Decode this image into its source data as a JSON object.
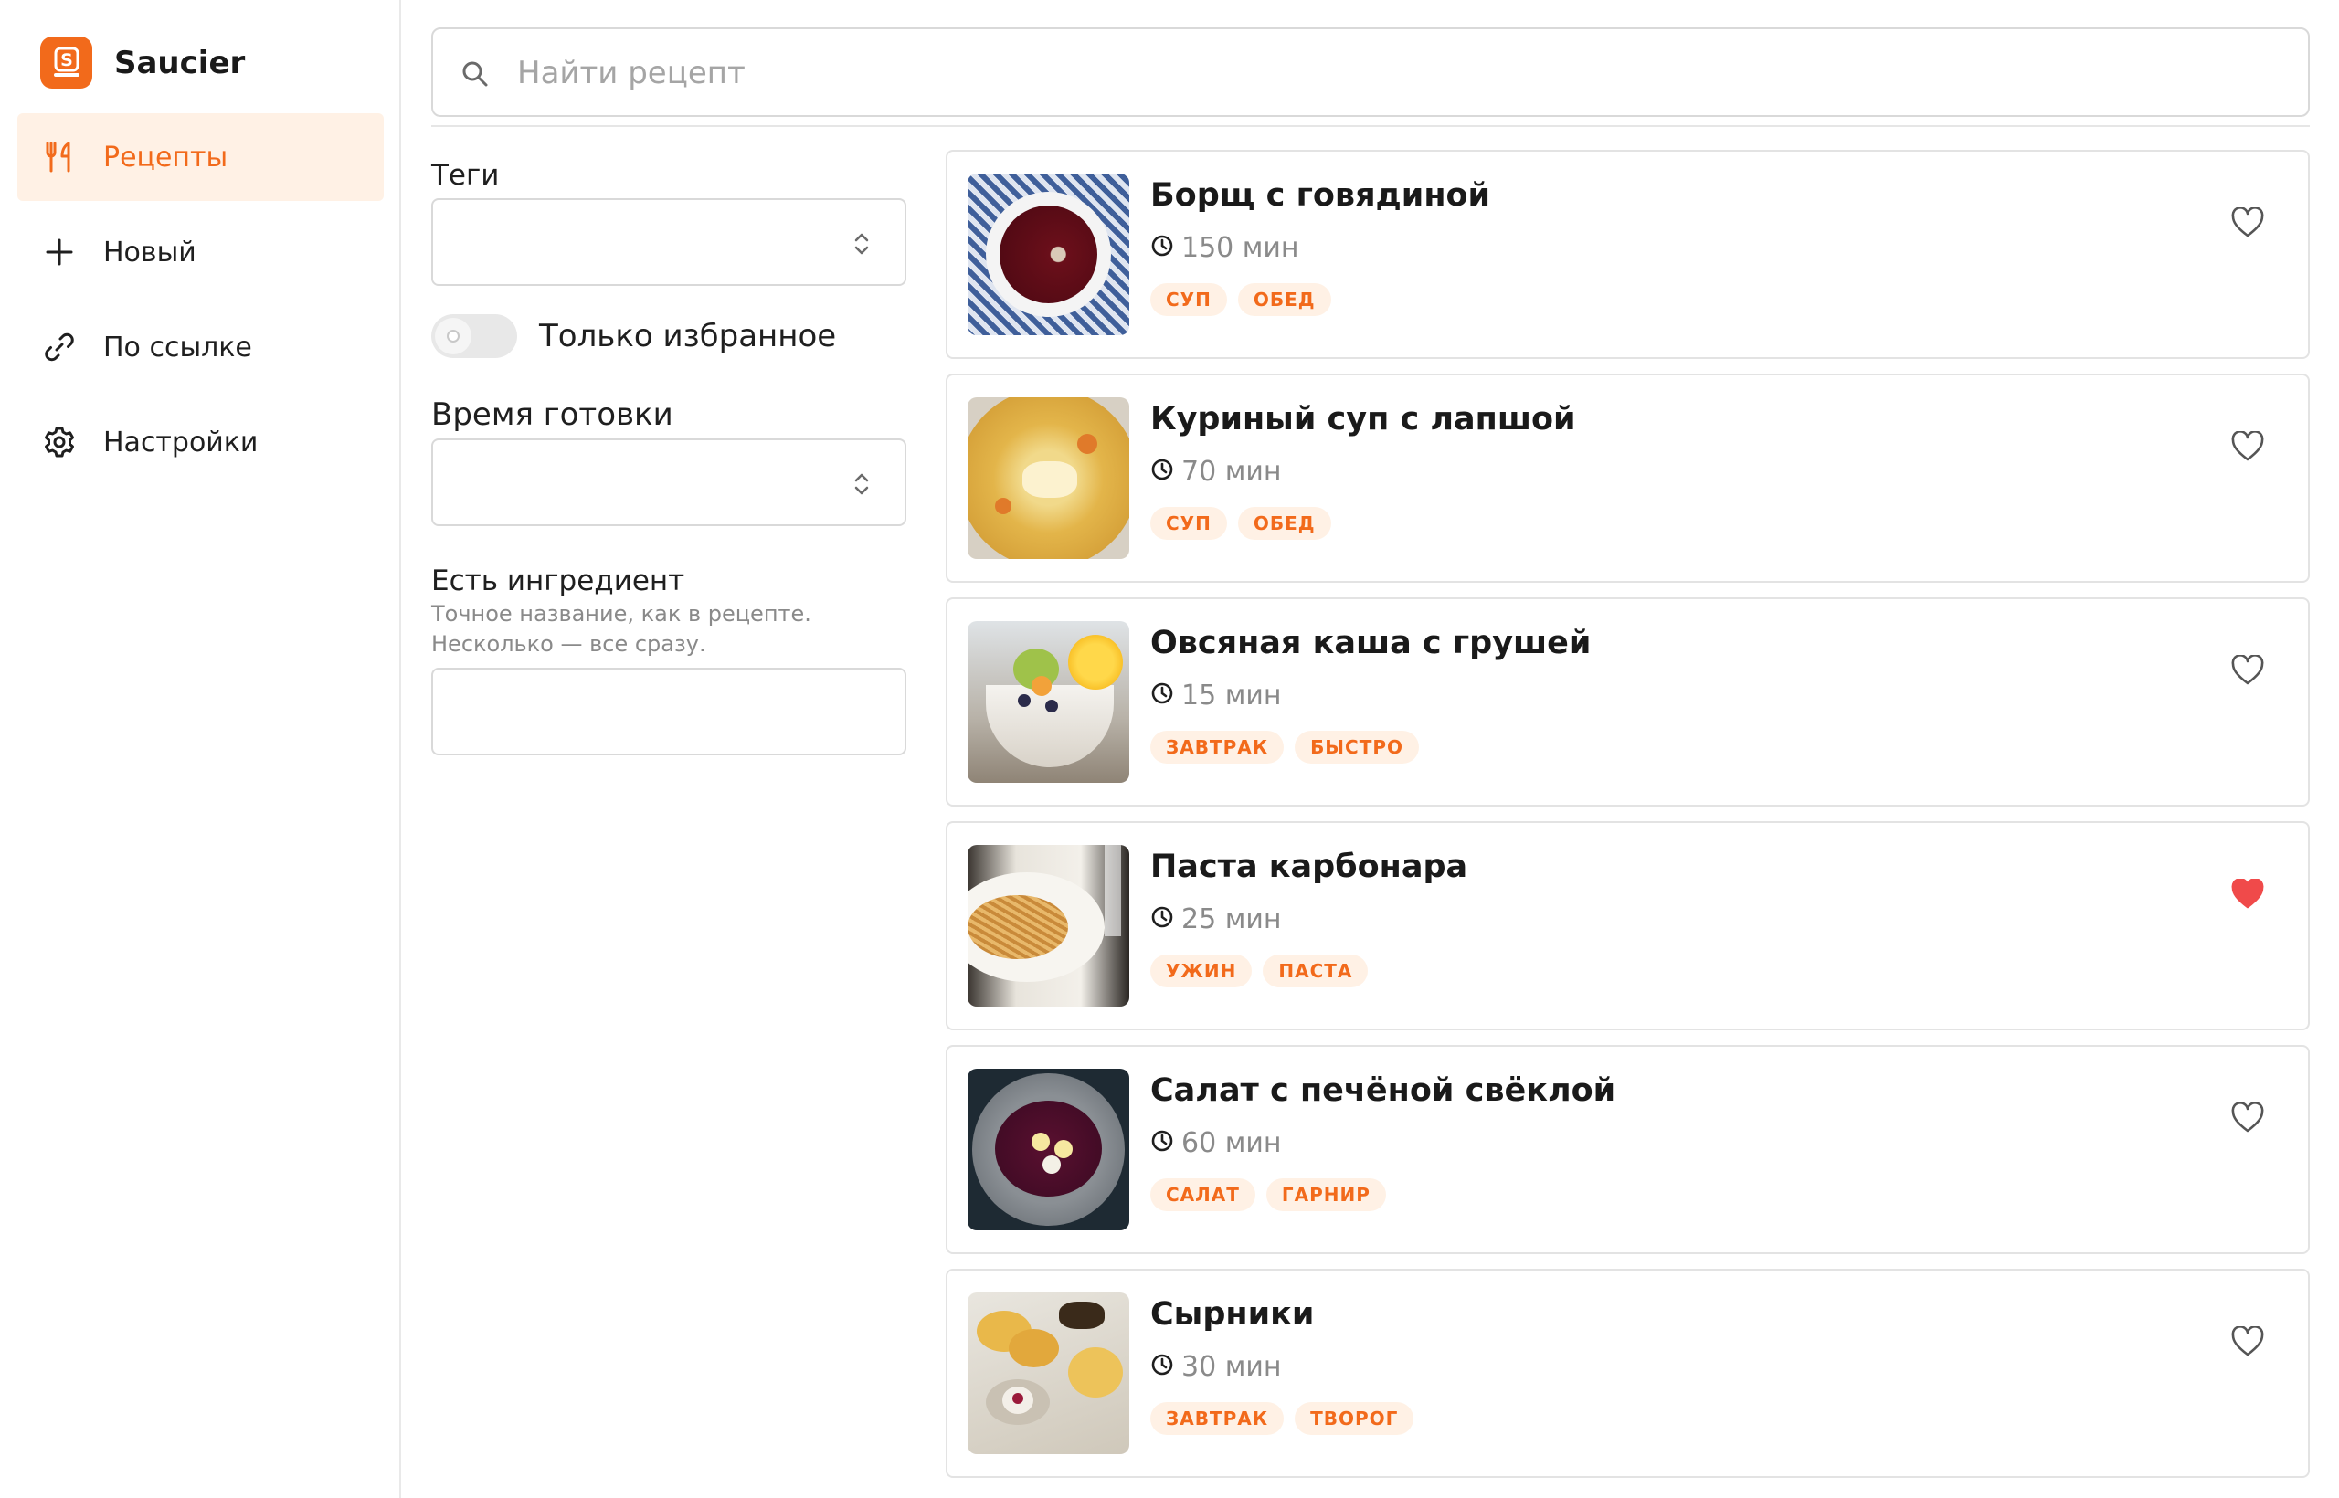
{
  "app": {
    "name": "Saucier"
  },
  "nav": {
    "items": [
      {
        "label": "Рецепты",
        "icon": "cutlery-icon",
        "active": true
      },
      {
        "label": "Новый",
        "icon": "plus-icon",
        "active": false
      },
      {
        "label": "По ссылке",
        "icon": "link-icon",
        "active": false
      },
      {
        "label": "Настройки",
        "icon": "gear-icon",
        "active": false
      }
    ]
  },
  "search": {
    "placeholder": "Найти рецепт",
    "value": ""
  },
  "filters": {
    "tags_label": "Теги",
    "tags_value": "",
    "favorites_only_label": "Только избранное",
    "favorites_only": false,
    "cook_time_label": "Время готовки",
    "cook_time_value": "",
    "ingredient_label": "Есть ингредиент",
    "ingredient_hint": "Точное название, как в рецепте. Несколько — все сразу.",
    "ingredient_value": ""
  },
  "recipes": [
    {
      "title": "Борщ с говядиной",
      "time": "150 мин",
      "tags": [
        "СУП",
        "ОБЕД"
      ],
      "favorite": false,
      "image": "borscht"
    },
    {
      "title": "Куриный суп с лапшой",
      "time": "70 мин",
      "tags": [
        "СУП",
        "ОБЕД"
      ],
      "favorite": false,
      "image": "chicken-noodle-soup"
    },
    {
      "title": "Овсяная каша с грушей",
      "time": "15 мин",
      "tags": [
        "ЗАВТРАК",
        "БЫСТРО"
      ],
      "favorite": false,
      "image": "oatmeal"
    },
    {
      "title": "Паста карбонара",
      "time": "25 мин",
      "tags": [
        "УЖИН",
        "ПАСТА"
      ],
      "favorite": true,
      "image": "carbonara"
    },
    {
      "title": "Салат с печёной свёклой",
      "time": "60 мин",
      "tags": [
        "САЛАТ",
        "ГАРНИР"
      ],
      "favorite": false,
      "image": "beet-salad"
    },
    {
      "title": "Сырники",
      "time": "30 мин",
      "tags": [
        "ЗАВТРАК",
        "ТВОРОГ"
      ],
      "favorite": false,
      "image": "syrniki"
    }
  ],
  "colors": {
    "accent": "#f26a1b",
    "accent_soft": "#fff1e5",
    "favorite": "#f04a4a",
    "muted": "#8a8a8a"
  }
}
